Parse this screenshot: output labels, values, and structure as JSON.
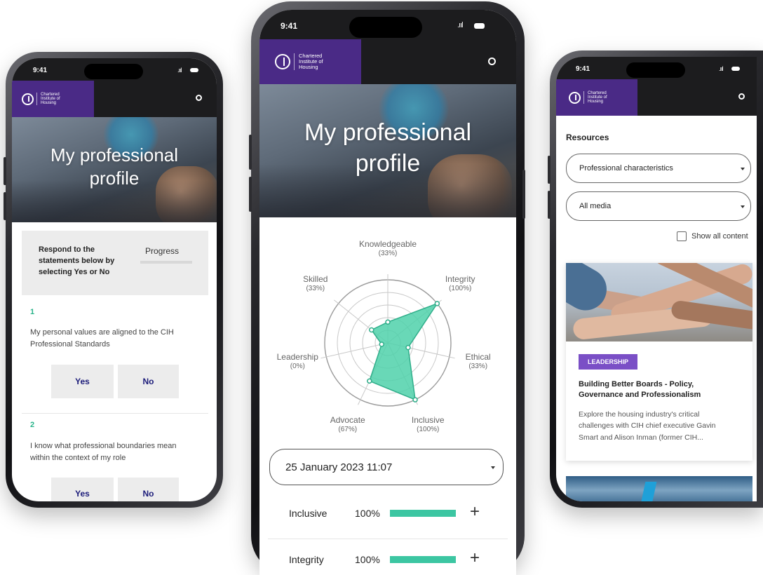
{
  "status": {
    "time": "9:41"
  },
  "brand": {
    "logo_line1": "Chartered",
    "logo_line2": "Institute of",
    "logo_line3": "Housing"
  },
  "hero": {
    "title_line1": "My professional",
    "title_line2": "profile"
  },
  "questionnaire": {
    "intro": [
      "Respond to the",
      "statements below by",
      "selecting Yes or No"
    ],
    "progress_label": "Progress",
    "progress_value": 0,
    "questions": [
      {
        "number": "1",
        "text_line1": "My personal values are aligned to the CIH",
        "text_line2": "Professional Standards",
        "yes": "Yes",
        "no": "No"
      },
      {
        "number": "2",
        "text_line1": "I know what professional boundaries mean",
        "text_line2": "within the context of my role",
        "yes": "Yes",
        "no": "No"
      }
    ]
  },
  "profile": {
    "date_selected": "25 January 2023 11:07",
    "scores": [
      {
        "name": "Inclusive",
        "pct": "100%",
        "value": 100
      },
      {
        "name": "Integrity",
        "pct": "100%",
        "value": 100
      }
    ]
  },
  "chart_data": {
    "type": "radar",
    "axes": [
      "Knowledgeable",
      "Integrity",
      "Ethical",
      "Inclusive",
      "Advocate",
      "Leadership",
      "Skilled"
    ],
    "labels": [
      "(33%)",
      "(100%)",
      "(33%)",
      "(100%)",
      "(67%)",
      "(0%)",
      "(33%)"
    ],
    "values": [
      33,
      100,
      33,
      100,
      67,
      0,
      33
    ],
    "range": [
      0,
      100
    ],
    "fill_color": "#4fd1aa",
    "grid": true
  },
  "resources": {
    "title": "Resources",
    "filter_topic": "Professional characteristics",
    "filter_media": "All media",
    "show_all_label": "Show all content",
    "card": {
      "tag": "LEADERSHIP",
      "title_line1": "Building Better Boards - Policy,",
      "title_line2": "Governance and Professionalism",
      "desc_line1": "Explore the housing industry's critical",
      "desc_line2": "challenges with CIH chief executive Gavin",
      "desc_line3": "Smart and Alison Inman (former CIH..."
    }
  },
  "colors": {
    "brand_purple": "#4a2a86",
    "accent_green": "#3cc6a2",
    "tag_purple": "#7a4fc6",
    "header_dark": "#1c1c1e"
  }
}
